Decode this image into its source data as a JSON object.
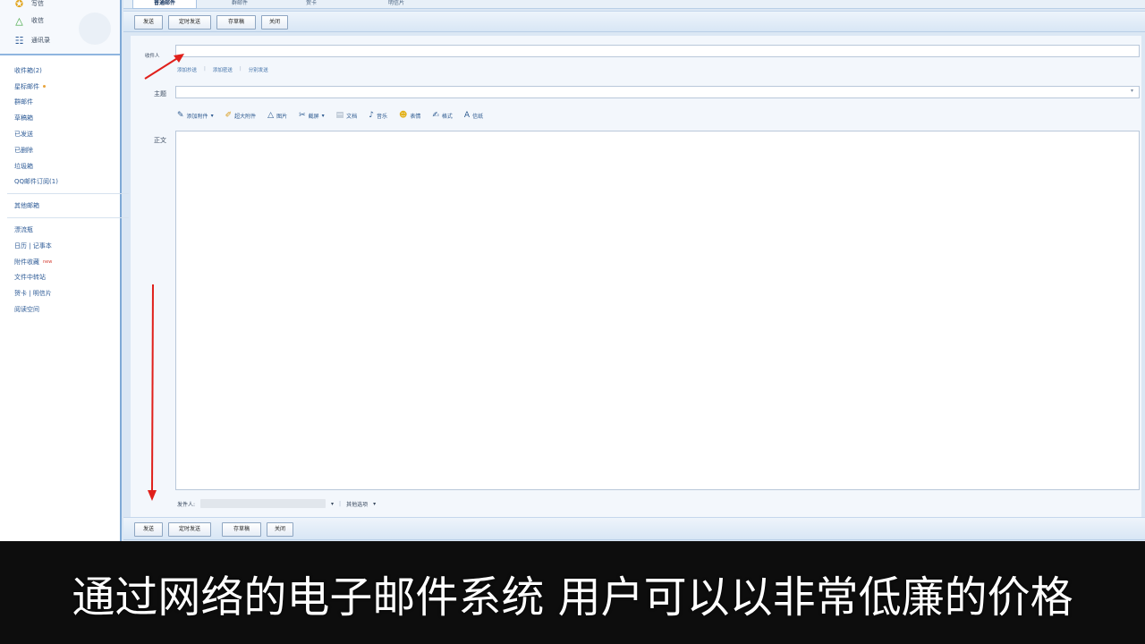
{
  "sidebar": {
    "top": [
      {
        "icon": "star-icon",
        "label": "写信"
      },
      {
        "icon": "triangle-icon",
        "label": "收信"
      },
      {
        "icon": "contacts-icon",
        "label": "通讯录"
      }
    ],
    "folders_a": [
      "收件箱(2)",
      "星标邮件",
      "群邮件",
      "草稿箱",
      "已发送",
      "已删除",
      "垃圾箱",
      "QQ邮件订阅(1)"
    ],
    "folders_b": [
      "其他邮箱"
    ],
    "folders_c": [
      "漂流瓶",
      "日历 | 记事本",
      "附件收藏",
      "文件中转站",
      "贺卡 | 明信片",
      "阅读空间"
    ]
  },
  "tabs": [
    "普通邮件",
    "群邮件",
    "贺卡",
    "明信片"
  ],
  "toolbar": {
    "buttons": [
      "发送",
      "定时发送",
      "存草稿",
      "关闭"
    ]
  },
  "compose": {
    "to_label": "收件人",
    "to_value": "",
    "to_links": [
      "添加抄送",
      "添加密送",
      "分别发送"
    ],
    "subject_label": "主题",
    "subject_value": "",
    "body_label": "正文",
    "format_tools": [
      {
        "icon": "pencil-icon",
        "label": "添加附件"
      },
      {
        "icon": "pen-icon",
        "label": "超大附件"
      },
      {
        "icon": "warning-icon",
        "label": "图片"
      },
      {
        "icon": "scissors-icon",
        "label": "截屏"
      },
      {
        "icon": "doc-icon",
        "label": "文档"
      },
      {
        "icon": "music-icon",
        "label": "音乐"
      },
      {
        "icon": "smile-icon",
        "label": "表情"
      },
      {
        "icon": "brush-icon",
        "label": "格式"
      },
      {
        "icon": "font-icon",
        "label": "信纸"
      }
    ],
    "sender_label": "发件人:",
    "sender_option": "其他选项"
  },
  "subtitle": "通过网络的电子邮件系统 用户可以以非常低廉的价格",
  "colors": {
    "accent": "#2f5c97",
    "annotation": "#e0201b"
  }
}
